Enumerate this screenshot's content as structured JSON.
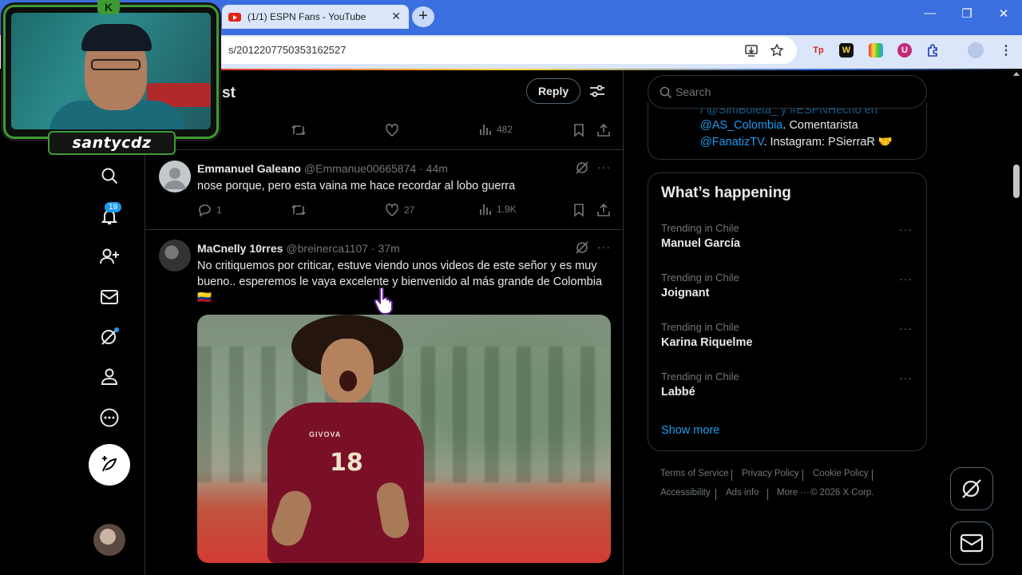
{
  "browser": {
    "tab_title": "(1/1) ESPN Fans - YouTube",
    "tab_close": "✕",
    "new_tab": "+",
    "url": "s/2012207750353162527",
    "window_min": "—",
    "window_restore": "❐",
    "window_close": "✕"
  },
  "webcam": {
    "streamer_name": "santycdz",
    "badge": "K"
  },
  "nav": {
    "notification_count": "19"
  },
  "header": {
    "title_fragment": "st",
    "reply_label": "Reply"
  },
  "prev_tweet_actions": {
    "views": "482"
  },
  "tweets": [
    {
      "name": "Emmanuel Galeano",
      "handle": "@Emmanue00665874 · 44m",
      "text": "nose porque, pero esta vaina me hace recordar al lobo guerra",
      "replies": "1",
      "likes": "27",
      "views": "1.9K"
    },
    {
      "name": "MaCnelly 10rres",
      "handle": "@breinerca1107 · 37m",
      "text": "No critiquemos por criticar, estuve viendo unos videos de este señor y es muy bueno.. esperemos le vaya excelente y bienvenido al más grande de Colombia",
      "flag": "🇨🇴",
      "image_jersey_brand": "GIVOVA",
      "image_jersey_number": "18"
    }
  ],
  "search": {
    "placeholder": "Search"
  },
  "bio": {
    "line0": "/ @SimBoleta_ y #ESPNHecho en",
    "line1_link": "@AS_Colombia",
    "line1_text": ". Comentarista",
    "line2_link": "@FanatizTV",
    "line2_text": ". Instagram: PSierraR 🤝"
  },
  "trends": {
    "title": "What’s happening",
    "items": [
      {
        "context": "Trending in Chile",
        "name": "Manuel García"
      },
      {
        "context": "Trending in Chile",
        "name": "Joignant"
      },
      {
        "context": "Trending in Chile",
        "name": "Karina Riquelme"
      },
      {
        "context": "Trending in Chile",
        "name": "Labbé"
      }
    ],
    "show_more": "Show more"
  },
  "footer": {
    "terms": "Terms of Service",
    "privacy": "Privacy Policy",
    "cookie": "Cookie Policy",
    "accessibility": "Accessibility",
    "ads": "Ads info",
    "more": "More ···",
    "copyright": "© 2026 X Corp."
  },
  "colors": {
    "accent": "#1d9bf0",
    "background": "#000000",
    "border": "#2f3336",
    "muted": "#71767b",
    "browser_frame": "#3b6fe0",
    "webcam_frame": "#3f9a34"
  },
  "icons": [
    "search-icon",
    "bell-icon",
    "follow-icon",
    "mail-icon",
    "grok-icon",
    "profile-icon",
    "more-circle-icon",
    "post-feather-icon",
    "retweet-icon",
    "heart-icon",
    "views-icon",
    "bookmark-icon",
    "share-icon",
    "reply-icon",
    "filter-icon",
    "star-icon",
    "install-icon",
    "extension-icon"
  ]
}
